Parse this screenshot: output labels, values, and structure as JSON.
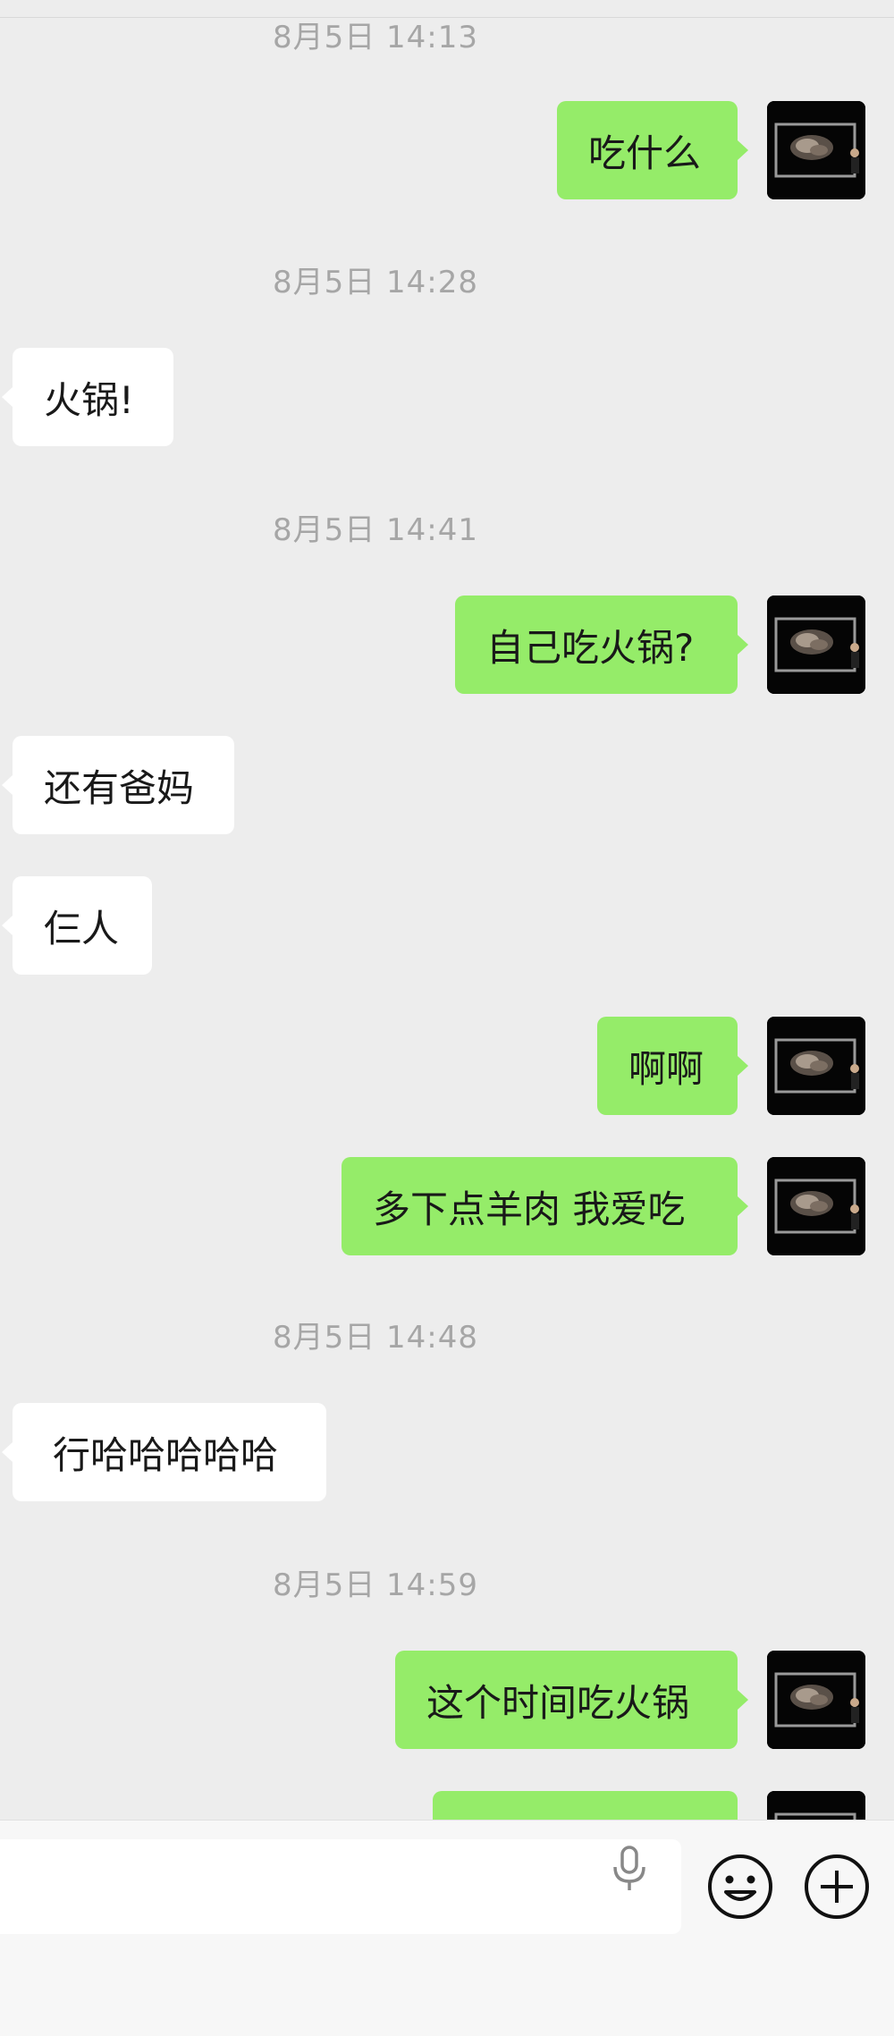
{
  "messages": [
    {
      "type": "time",
      "text": "8月5日 14:13"
    },
    {
      "type": "out",
      "text": "吃什么"
    },
    {
      "type": "time",
      "text": "8月5日 14:28"
    },
    {
      "type": "in",
      "text": "火锅!"
    },
    {
      "type": "time",
      "text": "8月5日 14:41"
    },
    {
      "type": "out",
      "text": "自己吃火锅?"
    },
    {
      "type": "in",
      "text": "还有爸妈"
    },
    {
      "type": "in",
      "text": "仨人"
    },
    {
      "type": "out",
      "text": "啊啊"
    },
    {
      "type": "out",
      "text": "多下点羊肉 我爱吃"
    },
    {
      "type": "time",
      "text": "8月5日 14:48"
    },
    {
      "type": "in",
      "text": "行哈哈哈哈哈"
    },
    {
      "type": "time",
      "text": "8月5日 14:59"
    },
    {
      "type": "out",
      "text": "这个时间吃火锅"
    },
    {
      "type": "out",
      "text": ""
    }
  ],
  "input_bar": {
    "message_value": "",
    "icons": [
      "mic-icon",
      "emoji-icon",
      "plus-icon"
    ]
  },
  "colors": {
    "background": "#ededed",
    "outgoing_bubble": "#95ec69",
    "incoming_bubble": "#ffffff",
    "timestamp_text": "#a6a6a6"
  }
}
